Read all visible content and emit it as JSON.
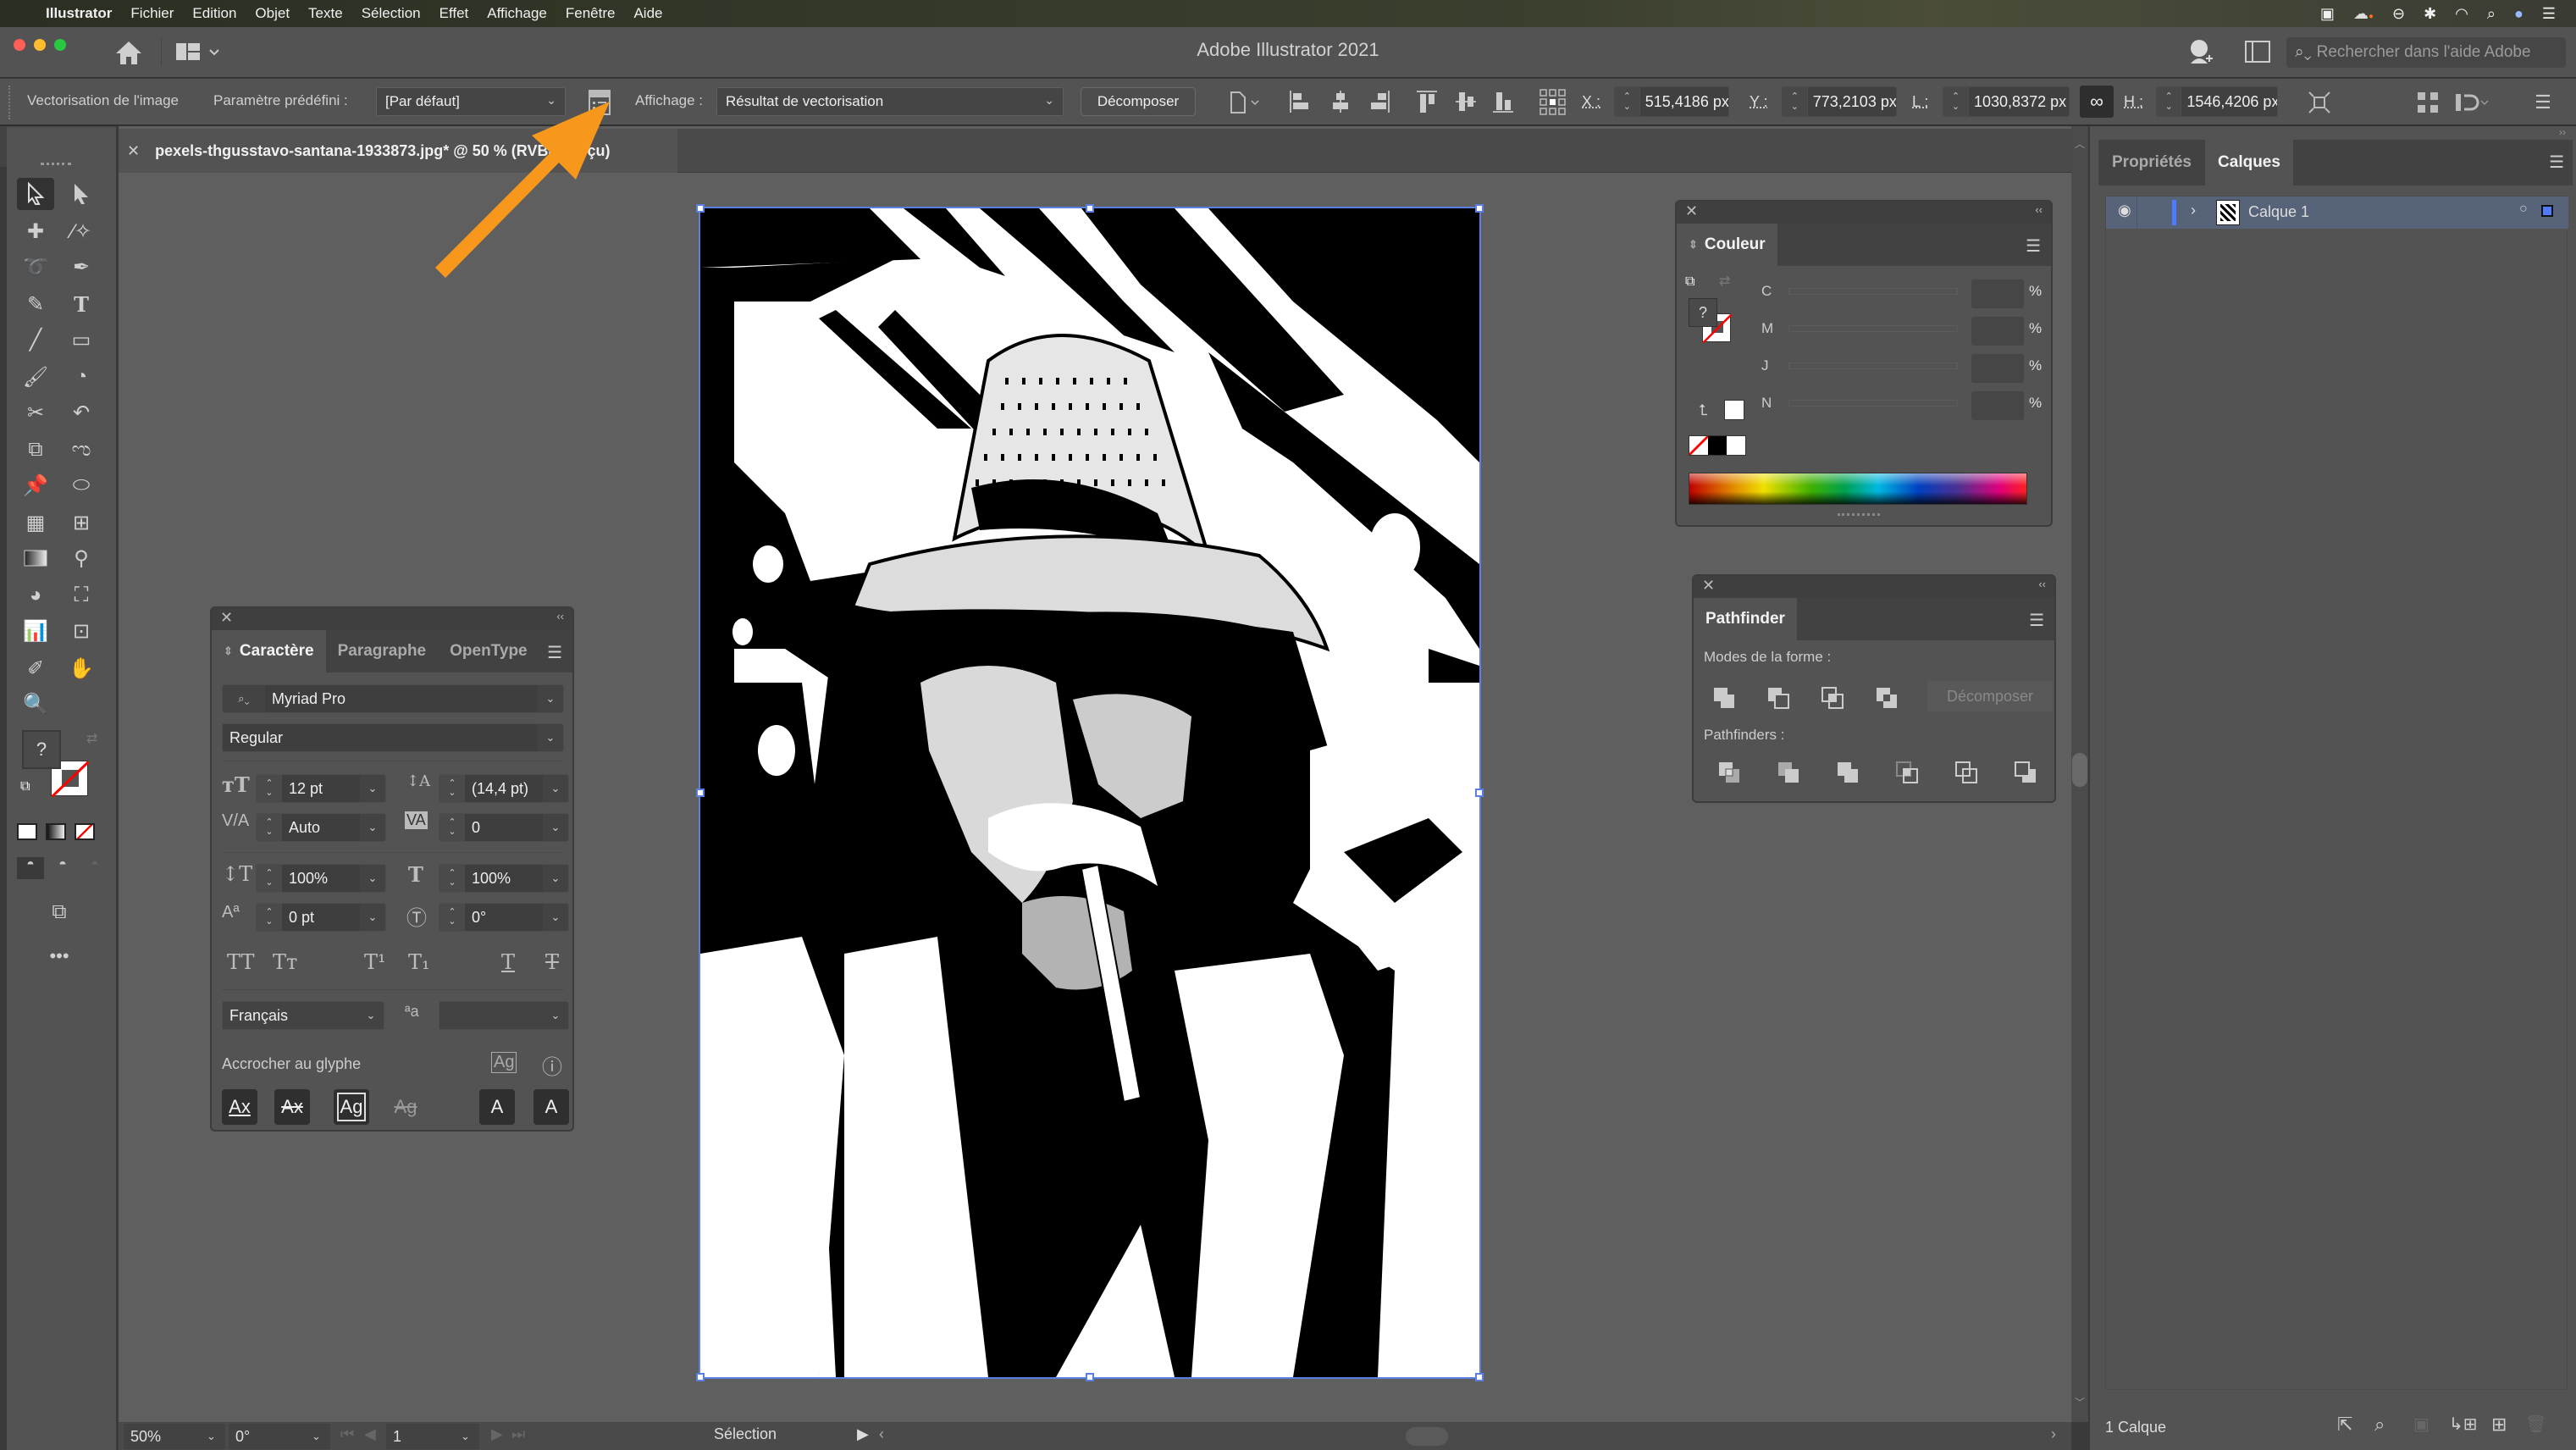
{
  "menubar": {
    "items": [
      "Illustrator",
      "Fichier",
      "Edition",
      "Objet",
      "Texte",
      "Sélection",
      "Effet",
      "Affichage",
      "Fenêtre",
      "Aide"
    ],
    "tray_icons": [
      "screen-record-icon",
      "creative-cloud-icon",
      "sync-icon",
      "bluetooth-icon",
      "wifi-icon",
      "spotlight-search-icon",
      "siri-icon",
      "control-center-icon"
    ]
  },
  "window": {
    "title": "Adobe Illustrator 2021"
  },
  "search": {
    "placeholder": "Rechercher dans l'aide Adobe"
  },
  "controlbar": {
    "context_label": "Vectorisation de l'image",
    "preset_label": "Paramètre prédéfini :",
    "preset_value": "[Par défaut]",
    "view_label": "Affichage :",
    "view_value": "Résultat de vectorisation",
    "expand_button": "Décomposer",
    "x_label": "X :",
    "x_value": "515,4186 px",
    "y_label": "Y :",
    "y_value": "773,2103 px",
    "w_label": "L :",
    "w_value": "1030,8372 px",
    "h_label": "H :",
    "h_value": "1546,4206 px"
  },
  "document": {
    "tab_title": "pexels-thgusstavo-santana-1933873.jpg* @ 50 % (RVB/Aperçu)"
  },
  "statusbar": {
    "zoom": "50%",
    "rotation": "0°",
    "artboard": "1",
    "tool": "Sélection"
  },
  "character_panel": {
    "tabs": [
      "Caractère",
      "Paragraphe",
      "OpenType"
    ],
    "active_tab": "Caractère",
    "font_family": "Myriad Pro",
    "font_style": "Regular",
    "font_size": "12 pt",
    "leading": "(14,4 pt)",
    "kerning": "Auto",
    "tracking": "0",
    "vertical_scale": "100%",
    "horizontal_scale": "100%",
    "baseline_shift": "0 pt",
    "rotation": "0°",
    "text_styles": [
      "TT",
      "Tт",
      "T¹",
      "T₁",
      "T",
      "T"
    ],
    "language": "Français",
    "snap_label": "Accrocher au glyphe",
    "snap_buttons": [
      "Ax",
      "Ax",
      "Ag",
      "Ag",
      "A",
      "A"
    ]
  },
  "color_panel": {
    "title": "Couleur",
    "channels": [
      {
        "label": "C",
        "value": "",
        "unit": "%"
      },
      {
        "label": "M",
        "value": "",
        "unit": "%"
      },
      {
        "label": "J",
        "value": "",
        "unit": "%"
      },
      {
        "label": "N",
        "value": "",
        "unit": "%"
      }
    ]
  },
  "pathfinder_panel": {
    "title": "Pathfinder",
    "shape_modes_label": "Modes de la forme :",
    "expand_button": "Décomposer",
    "pathfinders_label": "Pathfinders :",
    "shape_modes": [
      "unite",
      "minus-front",
      "intersect",
      "exclude"
    ],
    "pathfinders": [
      "divide",
      "trim",
      "merge",
      "crop",
      "outline",
      "minus-back"
    ]
  },
  "layers_panel": {
    "tabs": [
      "Propriétés",
      "Calques"
    ],
    "active_tab": "Calques",
    "layers": [
      {
        "name": "Calque 1",
        "visible": true,
        "color": "#4f7cff"
      }
    ],
    "count_label": "1 Calque"
  },
  "annotation": {
    "arrow_color": "#f7981d"
  }
}
